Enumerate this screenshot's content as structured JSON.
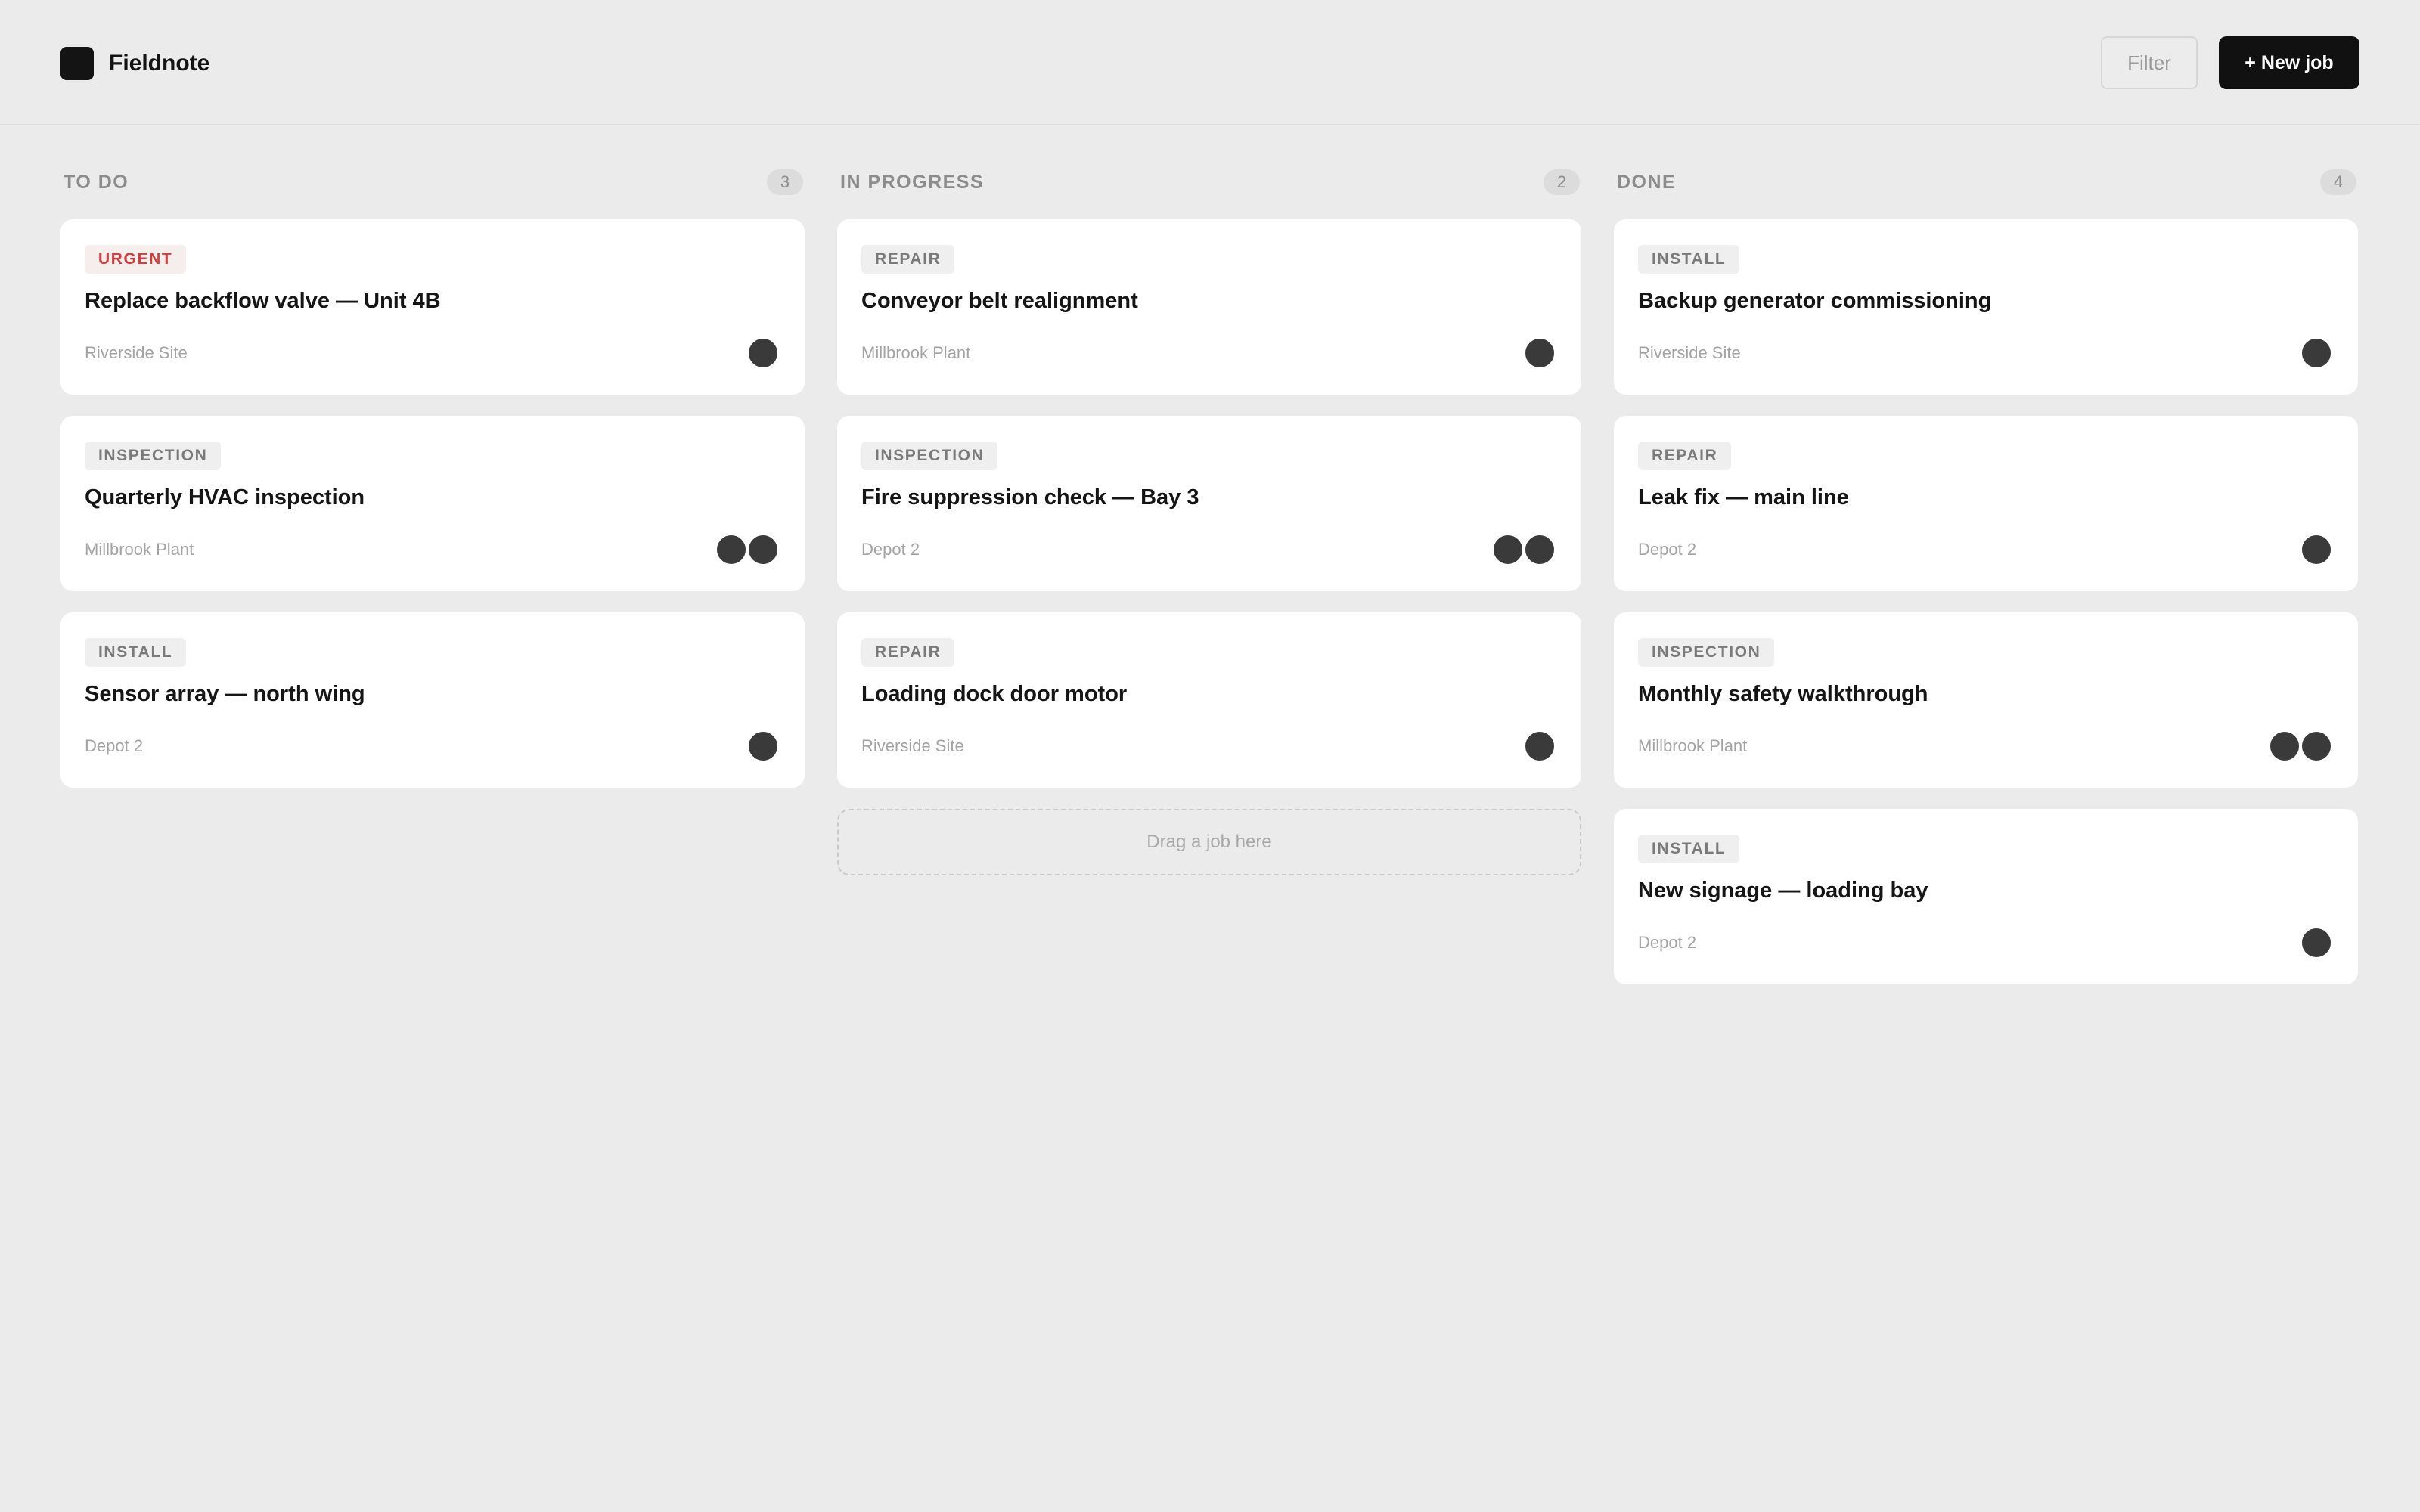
{
  "app": {
    "name": "Fieldnote"
  },
  "toolbar": {
    "filter_label": "Filter",
    "new_job_label": "+ New job"
  },
  "columns": [
    {
      "title": "TO DO",
      "count": "3",
      "cards": [
        {
          "tag": "URGENT",
          "tag_style": "urgent",
          "title": "Replace backflow valve — Unit 4B",
          "site": "Riverside Site",
          "assignees": 1
        },
        {
          "tag": "INSPECTION",
          "tag_style": "default",
          "title": "Quarterly HVAC inspection",
          "site": "Millbrook Plant",
          "assignees": 2
        },
        {
          "tag": "INSTALL",
          "tag_style": "default",
          "title": "Sensor array — north wing",
          "site": "Depot 2",
          "assignees": 1
        }
      ]
    },
    {
      "title": "IN PROGRESS",
      "count": "2",
      "cards": [
        {
          "tag": "REPAIR",
          "tag_style": "default",
          "title": "Conveyor belt realignment",
          "site": "Millbrook Plant",
          "assignees": 1
        },
        {
          "tag": "INSPECTION",
          "tag_style": "default",
          "title": "Fire suppression check — Bay 3",
          "site": "Depot 2",
          "assignees": 2
        },
        {
          "tag": "REPAIR",
          "tag_style": "default",
          "title": "Loading dock door motor",
          "site": "Riverside Site",
          "assignees": 1
        }
      ],
      "dropzone": "Drag a job here"
    },
    {
      "title": "DONE",
      "count": "4",
      "cards": [
        {
          "tag": "INSTALL",
          "tag_style": "default",
          "title": "Backup generator commissioning",
          "site": "Riverside Site",
          "assignees": 1
        },
        {
          "tag": "REPAIR",
          "tag_style": "default",
          "title": "Leak fix — main line",
          "site": "Depot 2",
          "assignees": 1
        },
        {
          "tag": "INSPECTION",
          "tag_style": "default",
          "title": "Monthly safety walkthrough",
          "site": "Millbrook Plant",
          "assignees": 2
        },
        {
          "tag": "INSTALL",
          "tag_style": "default",
          "title": "New signage — loading bay",
          "site": "Depot 2",
          "assignees": 1
        }
      ]
    }
  ],
  "colors": {
    "background": "#ebebeb",
    "card": "#ffffff",
    "primary": "#111111",
    "urgent": "#cf3d3d",
    "avatar": "#3a3a3a"
  }
}
